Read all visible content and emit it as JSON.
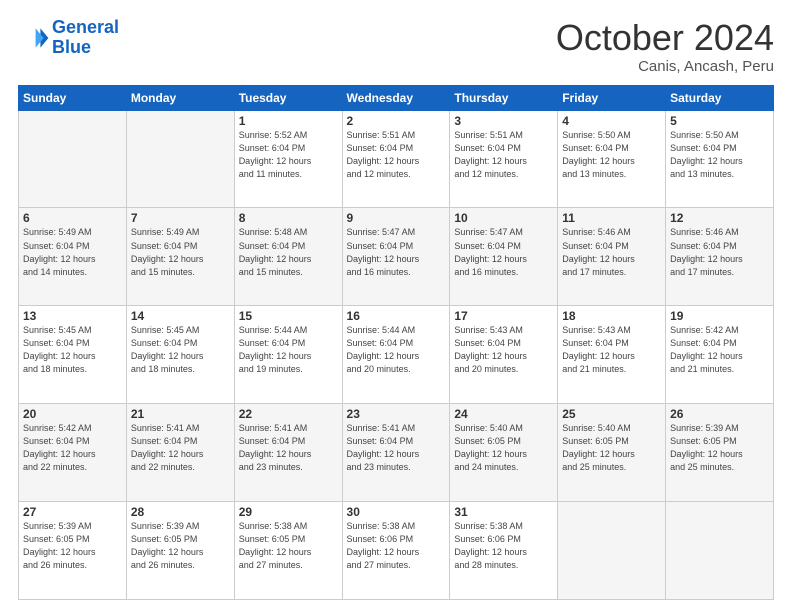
{
  "logo": {
    "line1": "General",
    "line2": "Blue"
  },
  "header": {
    "month": "October 2024",
    "location": "Canis, Ancash, Peru"
  },
  "weekdays": [
    "Sunday",
    "Monday",
    "Tuesday",
    "Wednesday",
    "Thursday",
    "Friday",
    "Saturday"
  ],
  "weeks": [
    [
      {
        "day": "",
        "info": ""
      },
      {
        "day": "",
        "info": ""
      },
      {
        "day": "1",
        "info": "Sunrise: 5:52 AM\nSunset: 6:04 PM\nDaylight: 12 hours\nand 11 minutes."
      },
      {
        "day": "2",
        "info": "Sunrise: 5:51 AM\nSunset: 6:04 PM\nDaylight: 12 hours\nand 12 minutes."
      },
      {
        "day": "3",
        "info": "Sunrise: 5:51 AM\nSunset: 6:04 PM\nDaylight: 12 hours\nand 12 minutes."
      },
      {
        "day": "4",
        "info": "Sunrise: 5:50 AM\nSunset: 6:04 PM\nDaylight: 12 hours\nand 13 minutes."
      },
      {
        "day": "5",
        "info": "Sunrise: 5:50 AM\nSunset: 6:04 PM\nDaylight: 12 hours\nand 13 minutes."
      }
    ],
    [
      {
        "day": "6",
        "info": "Sunrise: 5:49 AM\nSunset: 6:04 PM\nDaylight: 12 hours\nand 14 minutes."
      },
      {
        "day": "7",
        "info": "Sunrise: 5:49 AM\nSunset: 6:04 PM\nDaylight: 12 hours\nand 15 minutes."
      },
      {
        "day": "8",
        "info": "Sunrise: 5:48 AM\nSunset: 6:04 PM\nDaylight: 12 hours\nand 15 minutes."
      },
      {
        "day": "9",
        "info": "Sunrise: 5:47 AM\nSunset: 6:04 PM\nDaylight: 12 hours\nand 16 minutes."
      },
      {
        "day": "10",
        "info": "Sunrise: 5:47 AM\nSunset: 6:04 PM\nDaylight: 12 hours\nand 16 minutes."
      },
      {
        "day": "11",
        "info": "Sunrise: 5:46 AM\nSunset: 6:04 PM\nDaylight: 12 hours\nand 17 minutes."
      },
      {
        "day": "12",
        "info": "Sunrise: 5:46 AM\nSunset: 6:04 PM\nDaylight: 12 hours\nand 17 minutes."
      }
    ],
    [
      {
        "day": "13",
        "info": "Sunrise: 5:45 AM\nSunset: 6:04 PM\nDaylight: 12 hours\nand 18 minutes."
      },
      {
        "day": "14",
        "info": "Sunrise: 5:45 AM\nSunset: 6:04 PM\nDaylight: 12 hours\nand 18 minutes."
      },
      {
        "day": "15",
        "info": "Sunrise: 5:44 AM\nSunset: 6:04 PM\nDaylight: 12 hours\nand 19 minutes."
      },
      {
        "day": "16",
        "info": "Sunrise: 5:44 AM\nSunset: 6:04 PM\nDaylight: 12 hours\nand 20 minutes."
      },
      {
        "day": "17",
        "info": "Sunrise: 5:43 AM\nSunset: 6:04 PM\nDaylight: 12 hours\nand 20 minutes."
      },
      {
        "day": "18",
        "info": "Sunrise: 5:43 AM\nSunset: 6:04 PM\nDaylight: 12 hours\nand 21 minutes."
      },
      {
        "day": "19",
        "info": "Sunrise: 5:42 AM\nSunset: 6:04 PM\nDaylight: 12 hours\nand 21 minutes."
      }
    ],
    [
      {
        "day": "20",
        "info": "Sunrise: 5:42 AM\nSunset: 6:04 PM\nDaylight: 12 hours\nand 22 minutes."
      },
      {
        "day": "21",
        "info": "Sunrise: 5:41 AM\nSunset: 6:04 PM\nDaylight: 12 hours\nand 22 minutes."
      },
      {
        "day": "22",
        "info": "Sunrise: 5:41 AM\nSunset: 6:04 PM\nDaylight: 12 hours\nand 23 minutes."
      },
      {
        "day": "23",
        "info": "Sunrise: 5:41 AM\nSunset: 6:04 PM\nDaylight: 12 hours\nand 23 minutes."
      },
      {
        "day": "24",
        "info": "Sunrise: 5:40 AM\nSunset: 6:05 PM\nDaylight: 12 hours\nand 24 minutes."
      },
      {
        "day": "25",
        "info": "Sunrise: 5:40 AM\nSunset: 6:05 PM\nDaylight: 12 hours\nand 25 minutes."
      },
      {
        "day": "26",
        "info": "Sunrise: 5:39 AM\nSunset: 6:05 PM\nDaylight: 12 hours\nand 25 minutes."
      }
    ],
    [
      {
        "day": "27",
        "info": "Sunrise: 5:39 AM\nSunset: 6:05 PM\nDaylight: 12 hours\nand 26 minutes."
      },
      {
        "day": "28",
        "info": "Sunrise: 5:39 AM\nSunset: 6:05 PM\nDaylight: 12 hours\nand 26 minutes."
      },
      {
        "day": "29",
        "info": "Sunrise: 5:38 AM\nSunset: 6:05 PM\nDaylight: 12 hours\nand 27 minutes."
      },
      {
        "day": "30",
        "info": "Sunrise: 5:38 AM\nSunset: 6:06 PM\nDaylight: 12 hours\nand 27 minutes."
      },
      {
        "day": "31",
        "info": "Sunrise: 5:38 AM\nSunset: 6:06 PM\nDaylight: 12 hours\nand 28 minutes."
      },
      {
        "day": "",
        "info": ""
      },
      {
        "day": "",
        "info": ""
      }
    ]
  ]
}
